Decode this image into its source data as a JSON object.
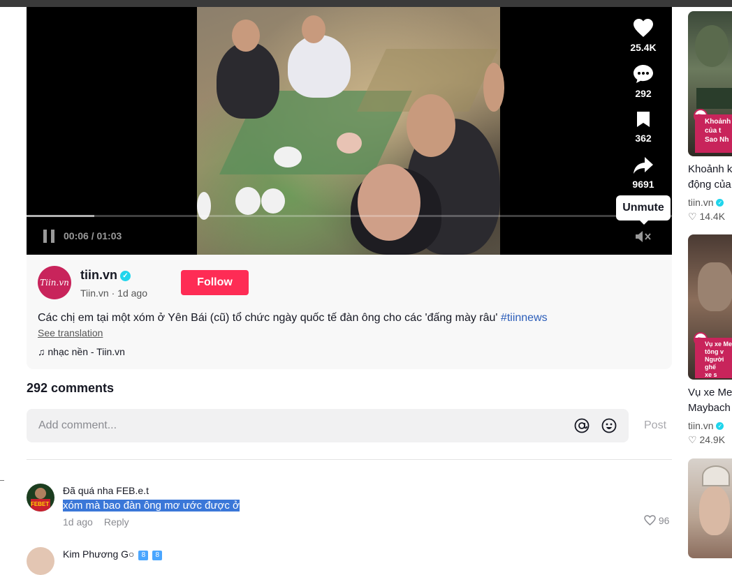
{
  "video": {
    "current_time": "00:06",
    "duration": "01:03",
    "time_display": "00:06 / 01:03",
    "progress_fraction": 0.105,
    "likes": "25.4K",
    "comments": "292",
    "saves": "362",
    "shares": "9691",
    "tooltip": "Unmute"
  },
  "post": {
    "avatar_text": "Tiin.vn",
    "author": "tiin.vn",
    "author_meta": "Tiin.vn · 1d ago",
    "follow_label": "Follow",
    "description": "Các chị em tại một xóm ở Yên Bái (cũ) tổ chức ngày quốc tế đàn ông cho các 'đấng mày râu'",
    "hashtag": "#tiinnews",
    "see_translation": "See translation",
    "music": "nhạc nền - Tiin.vn"
  },
  "comments_section": {
    "title": "292 comments",
    "placeholder": "Add comment...",
    "post_label": "Post",
    "items": [
      {
        "user": "Đã quá nha FEB.e.t",
        "text": "xóm mà bao đàn ông mơ ước được ở",
        "time": "1d ago",
        "reply": "Reply",
        "likes": "96"
      },
      {
        "user": "Kim Phương G",
        "badge1": "8",
        "badge2": "8"
      }
    ]
  },
  "rail": [
    {
      "title": "Khoảnh k",
      "title2": "động của",
      "author": "tiin.vn",
      "likes": "14.4K",
      "thumb_text": "Khoảnh k\ncủa t\nSao Nh"
    },
    {
      "title": "Vụ xe Me",
      "title2": "Maybach",
      "author": "tiin.vn",
      "likes": "24.9K",
      "thumb_text": "Vụ xe Me\ntông v\nNgười\nghế\nxe s"
    }
  ],
  "colors": {
    "accent": "#fe2c55",
    "verified": "#20d5ec",
    "hashtag": "#2b5db9",
    "brand": "#c8245b"
  }
}
